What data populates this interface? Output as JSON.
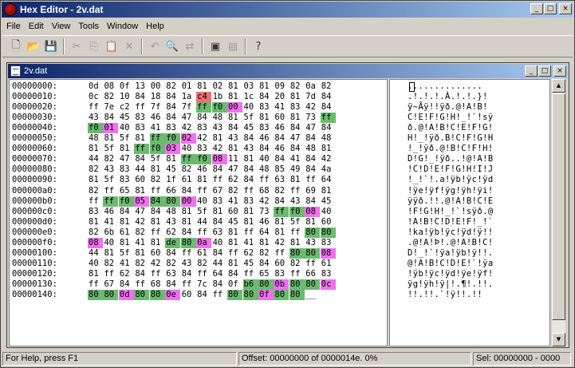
{
  "app": {
    "title": "Hex Editor - 2v.dat"
  },
  "window_buttons": {
    "minimize": "_",
    "maximize": "□",
    "close": "×"
  },
  "menu": [
    "File",
    "Edit",
    "View",
    "Tools",
    "Window",
    "Help"
  ],
  "toolbar": [
    {
      "name": "new-file-icon",
      "glyph": "🗋",
      "enabled": true
    },
    {
      "name": "open-folder-icon",
      "glyph": "📂",
      "enabled": true
    },
    {
      "name": "save-icon",
      "glyph": "💾",
      "enabled": true
    },
    {
      "sep": true
    },
    {
      "name": "cut-icon",
      "glyph": "✂",
      "enabled": false
    },
    {
      "name": "copy-icon",
      "glyph": "⎘",
      "enabled": false
    },
    {
      "name": "paste-icon",
      "glyph": "📋",
      "enabled": false
    },
    {
      "name": "delete-icon",
      "glyph": "✕",
      "enabled": false
    },
    {
      "sep": true
    },
    {
      "name": "undo-icon",
      "glyph": "↶",
      "enabled": false
    },
    {
      "name": "find-icon",
      "glyph": "🔍",
      "enabled": true
    },
    {
      "name": "replace-icon",
      "glyph": "⇄",
      "enabled": false
    },
    {
      "sep": true
    },
    {
      "name": "window-icon",
      "glyph": "▣",
      "enabled": true
    },
    {
      "name": "compare-icon",
      "glyph": "▤",
      "enabled": false
    },
    {
      "sep": true
    },
    {
      "name": "help-icon",
      "glyph": "?",
      "enabled": true
    }
  ],
  "document": {
    "title": "2v.dat",
    "rows": [
      {
        "offset": "00000000:",
        "bytes": [
          "0d",
          "08",
          "0f",
          "13",
          "00",
          "82",
          "01",
          "81",
          "02",
          "81",
          "03",
          "81",
          "09",
          "82",
          "0a",
          "82"
        ],
        "ascii": ".............."
      },
      {
        "offset": "00000010:",
        "bytes": [
          "0c",
          "82",
          "10",
          "84",
          "18",
          "84",
          "1a",
          "c4",
          "1b",
          "81",
          "1c",
          "84",
          "20",
          "81",
          "7d",
          "84"
        ],
        "ascii": ".!.!.!.À.!.!.}!",
        "hl": {
          "7": "r"
        }
      },
      {
        "offset": "00000020:",
        "bytes": [
          "ff",
          "7e",
          "c2",
          "ff",
          "7f",
          "84",
          "7f",
          "ff",
          "f0",
          "00",
          "40",
          "83",
          "41",
          "83",
          "42",
          "84"
        ],
        "ascii": "ÿ~Âÿ!!ÿð.@!A!B!",
        "hl": {
          "7": "g",
          "8": "g",
          "9": "p"
        }
      },
      {
        "offset": "00000030:",
        "bytes": [
          "43",
          "84",
          "45",
          "83",
          "46",
          "84",
          "47",
          "84",
          "48",
          "81",
          "5f",
          "81",
          "60",
          "81",
          "73",
          "ff"
        ],
        "ascii": "C!E!F!G!H!_!`!sÿ",
        "hl": {
          "15": "g"
        }
      },
      {
        "offset": "00000040:",
        "bytes": [
          "f0",
          "01",
          "40",
          "83",
          "41",
          "83",
          "42",
          "83",
          "43",
          "84",
          "45",
          "83",
          "46",
          "84",
          "47",
          "84"
        ],
        "ascii": "ð.@!A!B!C!E!F!G!",
        "hl": {
          "0": "g",
          "1": "p"
        }
      },
      {
        "offset": "00000050:",
        "bytes": [
          "48",
          "81",
          "5f",
          "81",
          "ff",
          "f0",
          "02",
          "42",
          "81",
          "43",
          "84",
          "46",
          "84",
          "47",
          "84",
          "48"
        ],
        "ascii": "H!_!ÿð.B!C!F!G!H",
        "hl": {
          "4": "g",
          "5": "g",
          "6": "p"
        }
      },
      {
        "offset": "00000060:",
        "bytes": [
          "81",
          "5f",
          "81",
          "ff",
          "f0",
          "03",
          "40",
          "83",
          "42",
          "81",
          "43",
          "84",
          "46",
          "84",
          "48",
          "81"
        ],
        "ascii": "!_!ÿð.@!B!C!F!H!",
        "hl": {
          "3": "g",
          "4": "g",
          "5": "p"
        }
      },
      {
        "offset": "00000070:",
        "bytes": [
          "44",
          "82",
          "47",
          "84",
          "5f",
          "81",
          "ff",
          "f0",
          "08",
          "11",
          "81",
          "40",
          "84",
          "41",
          "84",
          "42"
        ],
        "ascii": "D!G!_!ÿð..!@!A!B",
        "hl": {
          "6": "g",
          "7": "g",
          "8": "p"
        }
      },
      {
        "offset": "00000080:",
        "bytes": [
          "82",
          "43",
          "83",
          "44",
          "81",
          "45",
          "82",
          "46",
          "84",
          "47",
          "84",
          "48",
          "85",
          "49",
          "84",
          "4a"
        ],
        "ascii": "!C!D!E!F!G!H!I!J"
      },
      {
        "offset": "00000090:",
        "bytes": [
          "81",
          "5f",
          "83",
          "60",
          "82",
          "1f",
          "61",
          "81",
          "ff",
          "62",
          "84",
          "ff",
          "63",
          "81",
          "ff",
          "64"
        ],
        "ascii": "!_!`!.a!ÿb!ÿc!ÿd"
      },
      {
        "offset": "000000a0:",
        "bytes": [
          "82",
          "ff",
          "65",
          "81",
          "ff",
          "66",
          "84",
          "ff",
          "67",
          "82",
          "ff",
          "68",
          "82",
          "ff",
          "69",
          "81"
        ],
        "ascii": "!ÿe!ÿf!ÿg!ÿh!ÿi!"
      },
      {
        "offset": "000000b0:",
        "bytes": [
          "ff",
          "ff",
          "f0",
          "05",
          "84",
          "80",
          "00",
          "40",
          "83",
          "41",
          "83",
          "42",
          "84",
          "43",
          "84",
          "45"
        ],
        "ascii": "ÿÿð.!!.@!A!B!C!E",
        "hl": {
          "1": "g",
          "2": "g",
          "3": "p",
          "4": "g",
          "5": "g",
          "6": "p"
        }
      },
      {
        "offset": "000000c0:",
        "bytes": [
          "83",
          "46",
          "84",
          "47",
          "84",
          "48",
          "81",
          "5f",
          "81",
          "60",
          "81",
          "73",
          "ff",
          "f0",
          "08",
          "40"
        ],
        "ascii": "!F!G!H!_!`!sÿð.@",
        "hl": {
          "12": "g",
          "13": "g",
          "14": "p"
        }
      },
      {
        "offset": "000000d0:",
        "bytes": [
          "81",
          "41",
          "81",
          "42",
          "81",
          "43",
          "81",
          "44",
          "84",
          "45",
          "81",
          "46",
          "81",
          "5f",
          "81",
          "60"
        ],
        "ascii": "!A!B!C!D!E!F!_!`"
      },
      {
        "offset": "000000e0:",
        "bytes": [
          "82",
          "6b",
          "61",
          "82",
          "ff",
          "62",
          "84",
          "ff",
          "63",
          "81",
          "ff",
          "64",
          "81",
          "ff",
          "80",
          "80"
        ],
        "ascii": "!ka!ÿb!ÿc!ÿd!ÿ!!",
        "hl": {
          "14": "g",
          "15": "g"
        }
      },
      {
        "offset": "000000f0:",
        "bytes": [
          "08",
          "40",
          "81",
          "41",
          "81",
          "de",
          "80",
          "0a",
          "40",
          "81",
          "41",
          "81",
          "42",
          "81",
          "43",
          "83"
        ],
        "ascii": ".@!A!Þ!.@!A!B!C!",
        "hl": {
          "0": "p",
          "5": "g",
          "6": "g",
          "7": "p"
        }
      },
      {
        "offset": "00000100:",
        "bytes": [
          "44",
          "81",
          "5f",
          "81",
          "60",
          "84",
          "ff",
          "61",
          "84",
          "ff",
          "62",
          "82",
          "ff",
          "80",
          "80",
          "08"
        ],
        "ascii": "D!_!`!ÿa!ÿb!ÿ!!.",
        "hl": {
          "13": "g",
          "14": "g",
          "15": "p"
        }
      },
      {
        "offset": "00000110:",
        "bytes": [
          "40",
          "82",
          "41",
          "82",
          "42",
          "82",
          "43",
          "82",
          "44",
          "81",
          "45",
          "84",
          "60",
          "82",
          "ff",
          "61"
        ],
        "ascii": "@!A!B!C!D!E!`!ÿa"
      },
      {
        "offset": "00000120:",
        "bytes": [
          "81",
          "ff",
          "62",
          "84",
          "ff",
          "63",
          "84",
          "ff",
          "64",
          "84",
          "ff",
          "65",
          "83",
          "ff",
          "66",
          "83"
        ],
        "ascii": "!ÿb!ÿc!ÿd!ÿe!ÿf!"
      },
      {
        "offset": "00000130:",
        "bytes": [
          "ff",
          "67",
          "84",
          "ff",
          "68",
          "84",
          "ff",
          "7c",
          "84",
          "0f",
          "b6",
          "80",
          "0b",
          "80",
          "80",
          "0c"
        ],
        "ascii": "ÿg!ÿh!ÿ|!.¶!.!!.",
        "hl": {
          "10": "g",
          "11": "g",
          "12": "p",
          "13": "g",
          "14": "g",
          "15": "p"
        }
      },
      {
        "offset": "00000140:",
        "bytes": [
          "80",
          "80",
          "0d",
          "80",
          "80",
          "0e",
          "60",
          "84",
          "ff",
          "80",
          "80",
          "0f",
          "80",
          "80",
          "__"
        ],
        "ascii": "!!.!!.`!ÿ!!.!!",
        "hl": {
          "0": "g",
          "1": "g",
          "2": "p",
          "3": "g",
          "4": "g",
          "5": "p",
          "9": "g",
          "10": "g",
          "11": "p",
          "12": "g",
          "13": "g"
        }
      }
    ]
  },
  "colors": {
    "changed": "#6bba70",
    "inserted": "#f070f0",
    "modified": "#f07070"
  },
  "status": {
    "help": "For Help, press F1",
    "offset": "Offset: 00000000 of 0000014e.  0%",
    "selection": "Sel: 00000000 - 0000"
  }
}
